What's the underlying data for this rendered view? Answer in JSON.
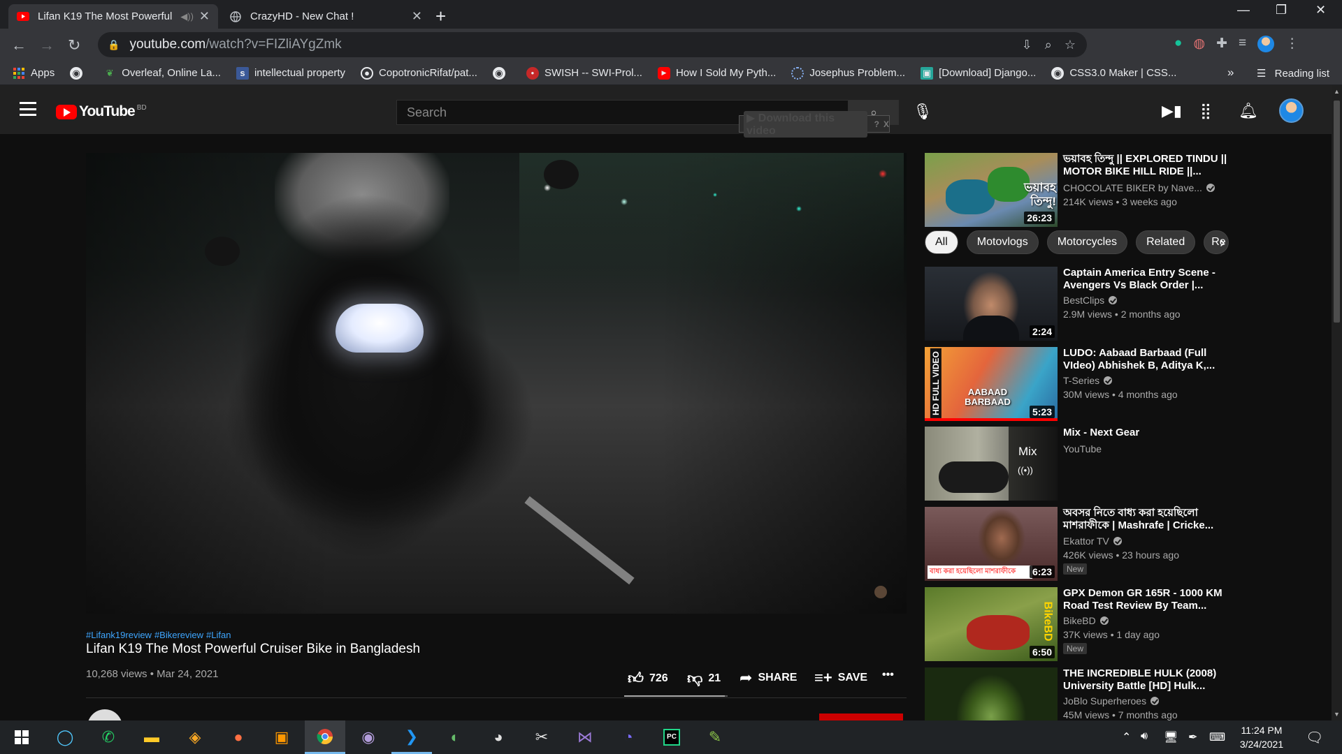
{
  "browser": {
    "tabs": [
      {
        "title": "Lifan K19 The Most Powerful",
        "active": true
      },
      {
        "title": "CrazyHD - New Chat !",
        "active": false
      }
    ],
    "new_tab": "+",
    "url_domain": "youtube.com",
    "url_path": "/watch?v=FIZliAYgZmk",
    "bookmarks": [
      {
        "label": "Apps",
        "icon": "apps-grid-icon"
      },
      {
        "label": "",
        "icon": "globe-icon"
      },
      {
        "label": "Overleaf, Online La...",
        "icon": "overleaf-leaf-icon"
      },
      {
        "label": "intellectual property",
        "icon": "scholar-s-icon"
      },
      {
        "label": "CopotronicRifat/pat...",
        "icon": "github-icon"
      },
      {
        "label": "",
        "icon": "globe-icon"
      },
      {
        "label": "SWISH -- SWI-Prol...",
        "icon": "swish-owl-icon"
      },
      {
        "label": "How I Sold My Pyth...",
        "icon": "youtube-icon"
      },
      {
        "label": "Josephus Problem...",
        "icon": "loading-circle-icon"
      },
      {
        "label": "[Download] Django...",
        "icon": "download-site-icon"
      },
      {
        "label": "CSS3.0 Maker | CSS...",
        "icon": "globe-icon"
      }
    ],
    "bookmarks_overflow": "»",
    "reading_list": "Reading list"
  },
  "youtube": {
    "country_code": "BD",
    "logo_text": "YouTube",
    "search_placeholder": "Search",
    "download_button": "Download this video",
    "download_help": "?",
    "download_close": "X"
  },
  "video": {
    "hashtags": [
      "#Lifank19review",
      "#Bikereview",
      "#Lifan"
    ],
    "title": "Lifan K19 The Most Powerful Cruiser Bike in Bangladesh",
    "meta": "10,268 views • Mar 24, 2021",
    "likes": "726",
    "dislikes": "21",
    "like_ratio": 0.97,
    "share": "SHARE",
    "save": "SAVE",
    "more": "•••"
  },
  "chips": [
    "All",
    "Motovlogs",
    "Motorcycles",
    "Related",
    "Re"
  ],
  "recommendations": [
    {
      "title": "ভয়াবহ তিন্দু || EXPLORED TINDU || MOTOR BIKE HILL RIDE ||...",
      "channel": "CHOCOLATE BIKER by Nave...",
      "verified": true,
      "views": "214K views • 3 weeks ago",
      "duration": "26:23",
      "badge": "",
      "thumb_text": "ভয়াবহ তিন্দু!"
    },
    {
      "title": "Captain America Entry Scene - Avengers Vs Black Order |...",
      "channel": "BestClips",
      "verified": true,
      "views": "2.9M views • 2 months ago",
      "duration": "2:24",
      "badge": "",
      "thumb_text": ""
    },
    {
      "title": "LUDO: Aabaad Barbaad (Full VIdeo) Abhishek B, Aditya K,...",
      "channel": "T-Series",
      "verified": true,
      "views": "30M views • 4 months ago",
      "duration": "5:23",
      "badge": "",
      "thumb_text": "AABAAD BARBAAD",
      "side_text": "HD FULL VIDEO"
    },
    {
      "title": "Mix - Next Gear",
      "channel": "YouTube",
      "verified": false,
      "views": "",
      "duration": "",
      "badge": "",
      "thumb_text": "Mix",
      "mix_icon": "((•))"
    },
    {
      "title": "অবসর নিতে বাধ্য করা হয়েছিলো মাশরাফীকে | Mashrafe | Cricke...",
      "channel": "Ekattor TV",
      "verified": true,
      "views": "426K views • 23 hours ago",
      "duration": "6:23",
      "badge": "New",
      "thumb_text": "বাধ্য করা হয়েছিলো মাশরাফীকে"
    },
    {
      "title": "GPX Demon GR 165R - 1000 KM Road Test Review By Team...",
      "channel": "BikeBD",
      "verified": true,
      "views": "37K views • 1 day ago",
      "duration": "6:50",
      "badge": "New",
      "thumb_text": "BikeBD"
    },
    {
      "title": "THE INCREDIBLE HULK (2008) University Battle [HD] Hulk...",
      "channel": "JoBlo Superheroes",
      "verified": true,
      "views": "45M views • 7 months ago",
      "duration": "",
      "badge": "",
      "thumb_text": ""
    }
  ],
  "taskbar": {
    "time": "11:24 PM",
    "date": "3/24/2021"
  }
}
